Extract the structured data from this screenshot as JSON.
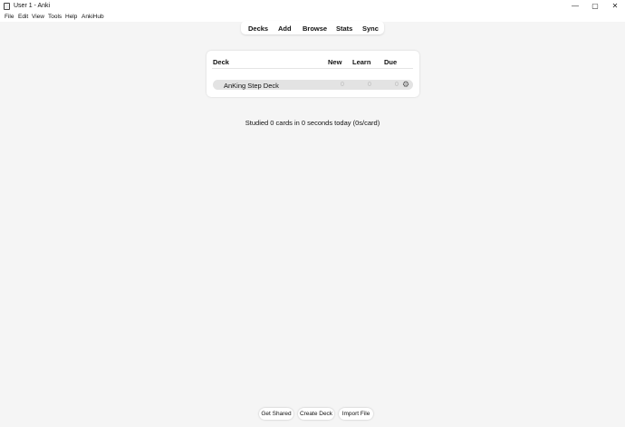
{
  "window": {
    "title": "User 1 - Anki",
    "icon": "anki-app-icon",
    "controls": {
      "minimize": "—",
      "maximize": "▢",
      "close": "✕"
    }
  },
  "menu": {
    "items": [
      "File",
      "Edit",
      "View",
      "Tools",
      "Help",
      "AnkiHub"
    ]
  },
  "toolbar": {
    "items": [
      "Decks",
      "Add",
      "Browse",
      "Stats",
      "Sync"
    ]
  },
  "deck_table": {
    "headers": {
      "deck": "Deck",
      "new": "New",
      "learn": "Learn",
      "due": "Due"
    },
    "rows": [
      {
        "name": "AnKing Step Deck",
        "new": "0",
        "learn": "0",
        "due": "0",
        "options_icon": "gear-icon"
      }
    ]
  },
  "studied_text": "Studied 0 cards in 0 seconds today (0s/card)",
  "bottom_buttons": [
    "Get Shared",
    "Create Deck",
    "Import File"
  ],
  "colors": {
    "background": "#f5f5f5",
    "card": "#ffffff",
    "deck_row": "#e3e3e3",
    "muted_count": "#bbbbbb"
  }
}
